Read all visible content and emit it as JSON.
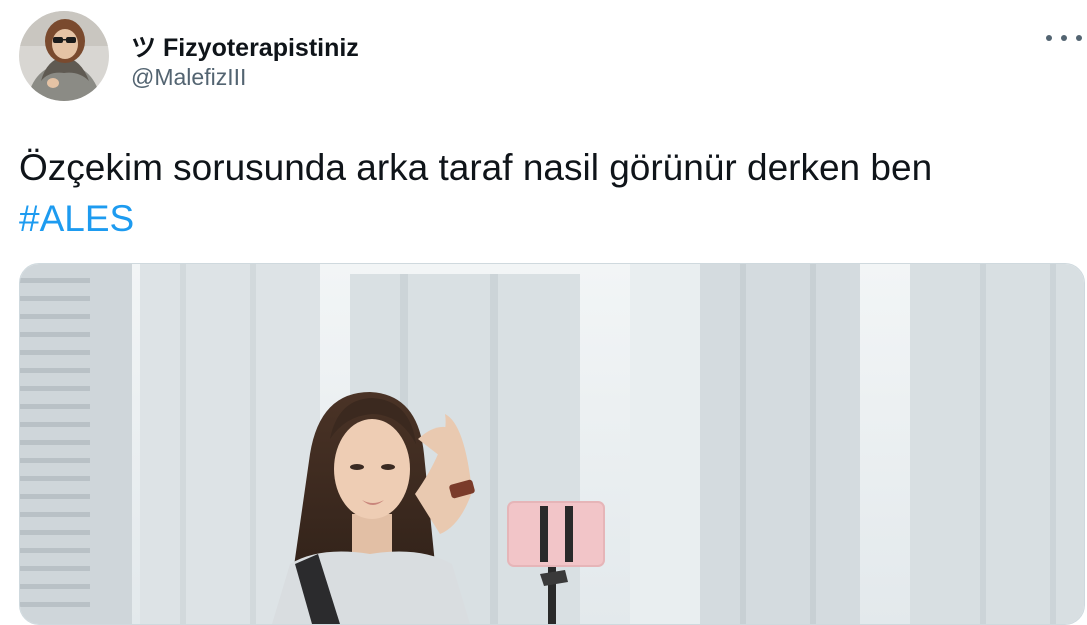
{
  "tweet": {
    "display_name": "ツ Fizyoterapistiniz",
    "handle": "@MalefizIII",
    "text": "Özçekim sorusunda arka taraf nasil görünür derken ben",
    "hashtag": "#ALES",
    "more_icon": "more-horizontal-icon",
    "avatar_icon": "avatar",
    "media_icon": "selfie-photo"
  },
  "colors": {
    "text": "#0f1419",
    "secondary": "#536471",
    "link": "#1d9bf0",
    "border": "#cfd9de"
  }
}
